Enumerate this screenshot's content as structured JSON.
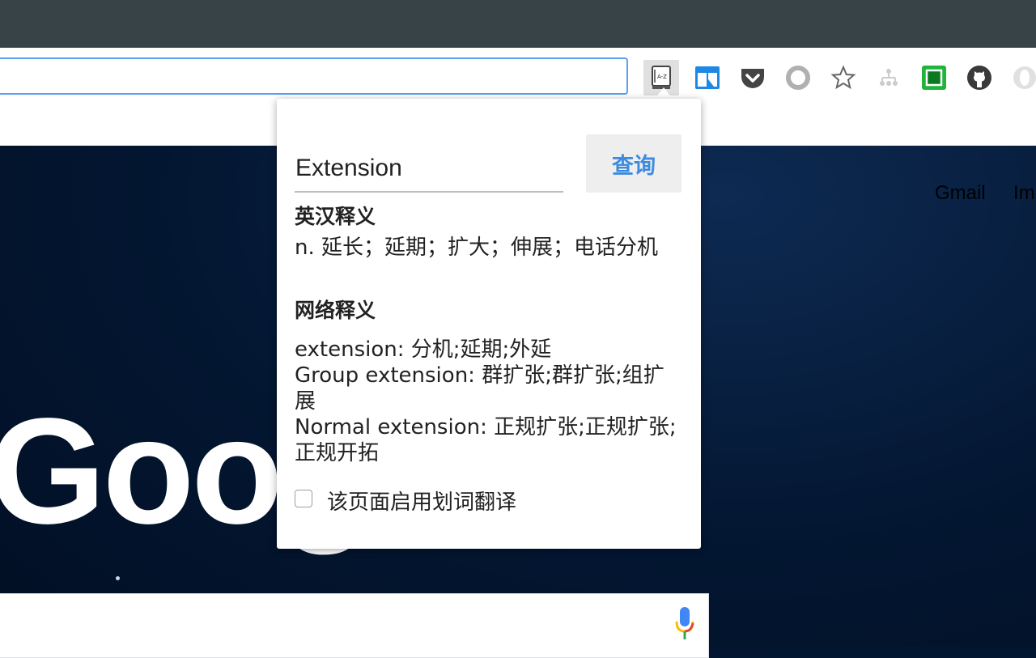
{
  "browser": {
    "extensions": [
      {
        "name": "dictionary-extension-icon",
        "active": true
      },
      {
        "name": "window-extension-icon"
      },
      {
        "name": "pocket-icon"
      },
      {
        "name": "ring-extension-icon"
      },
      {
        "name": "bookmark-star-icon"
      },
      {
        "name": "sitemap-extension-icon"
      },
      {
        "name": "green-square-extension-icon"
      },
      {
        "name": "github-icon"
      },
      {
        "name": "opera-extension-icon"
      }
    ]
  },
  "page": {
    "gmail_link": "Gmail",
    "images_link": "Im",
    "logo_text": "Goog"
  },
  "popup": {
    "query_value": "Extension",
    "query_button": "查询",
    "section1_title": "英汉释义",
    "section1_text": "n. 延长；延期；扩大；伸展；电话分机",
    "section2_title": "网络释义",
    "web_defs": [
      "extension: 分机;延期;外延",
      "Group extension: 群扩张;群扩张;组扩展",
      "Normal extension: 正规扩张;正规扩张;正规开拓"
    ],
    "checkbox_label": "该页面启用划词翻译",
    "checkbox_checked": false
  }
}
